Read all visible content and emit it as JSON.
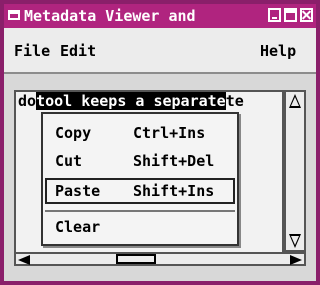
{
  "window": {
    "title": "Metadata Viewer and ",
    "accent_color": "#b0247f",
    "frame_color": "#8a1f6a"
  },
  "menubar": {
    "file_label": "File",
    "edit_label": "Edit",
    "help_label": "Help"
  },
  "content": {
    "text_prefix": "do",
    "text_selected": "tool keeps a separate",
    "text_suffix": "te"
  },
  "context_menu": {
    "items": [
      {
        "label": "Copy",
        "shortcut": "Ctrl+Ins"
      },
      {
        "label": "Cut",
        "shortcut": "Shift+Del"
      },
      {
        "label": "Paste",
        "shortcut": "Shift+Ins"
      },
      {
        "label": "Clear",
        "shortcut": ""
      }
    ]
  },
  "icons": {
    "window_menu": "window-menu-icon",
    "minimize": "minimize-icon",
    "maximize": "maximize-icon",
    "close": "close-icon",
    "scroll_up": "arrow-up-icon",
    "scroll_down": "arrow-down-icon",
    "scroll_left": "arrow-left-icon",
    "scroll_right": "arrow-right-icon"
  }
}
